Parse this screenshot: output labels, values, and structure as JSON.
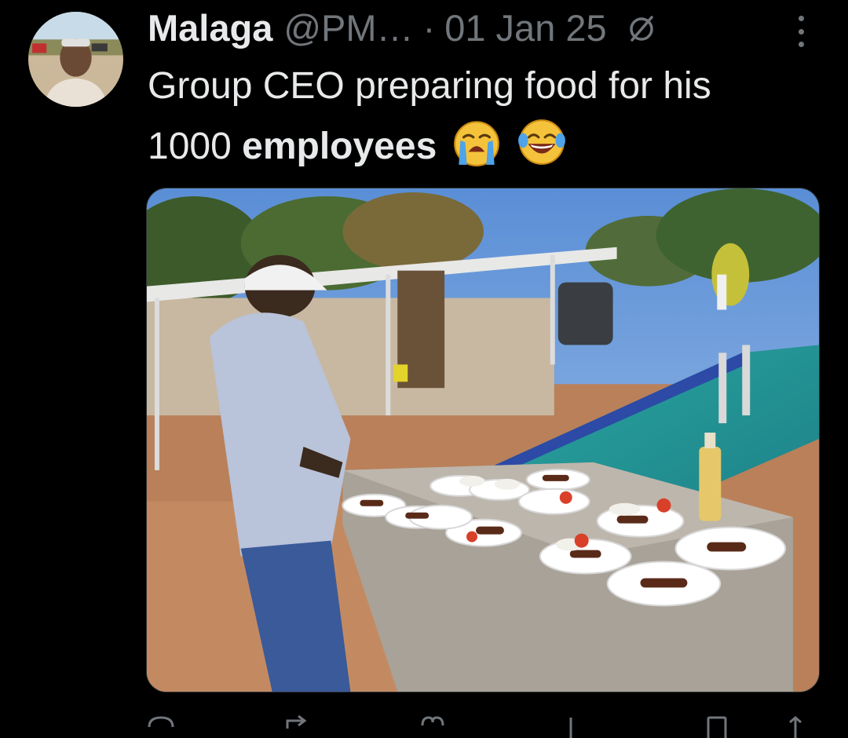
{
  "tweet": {
    "author": {
      "display_name": "Malaga",
      "handle": "@PM…"
    },
    "separator": "·",
    "date": "01 Jan 25",
    "text": {
      "part1": "Group CEO preparing food for his 1000 ",
      "bold": "employees",
      "emojis": [
        "loudly-crying-face",
        "face-with-tears-of-joy"
      ]
    }
  },
  "icons": {
    "edit": "edit-slash-icon",
    "more": "more-options-icon",
    "actions": [
      "reply-icon",
      "retweet-icon",
      "like-icon",
      "views-icon",
      "bookmark-icon",
      "share-icon"
    ]
  },
  "colors": {
    "background": "#000000",
    "text_primary": "#e7e9ea",
    "text_secondary": "#71767b"
  }
}
